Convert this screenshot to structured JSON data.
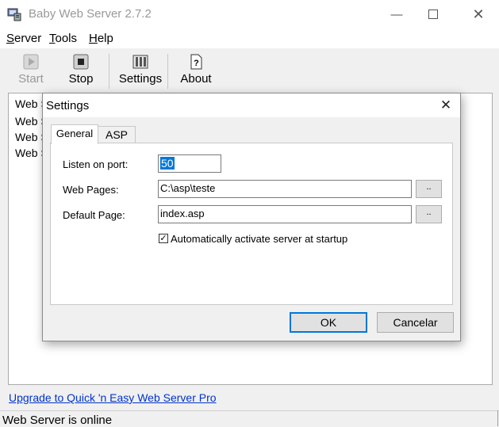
{
  "window": {
    "title": "Baby Web Server 2.7.2"
  },
  "menu": {
    "server_first": "S",
    "server_rest": "erver",
    "tools_first": "T",
    "tools_rest": "ools",
    "help_first": "H",
    "help_rest": "elp"
  },
  "toolbar": {
    "start": "Start",
    "stop": "Stop",
    "settings": "Settings",
    "about": "About"
  },
  "main_list": {
    "lines": [
      "Web S",
      "Web S",
      "Web S",
      "Web S"
    ]
  },
  "upgrade_link": "Upgrade to Quick 'n Easy Web Server Pro",
  "status": "Web Server is online",
  "dialog": {
    "title": "Settings",
    "tabs": [
      "General",
      "ASP"
    ],
    "listen_label": "Listen on port:",
    "listen_value": "50",
    "web_pages_label": "Web Pages:",
    "web_pages_value": "C:\\asp\\teste",
    "default_page_label": "Default Page:",
    "default_page_value": "index.asp",
    "browse_label": "..",
    "autostart_label": "Automatically activate server at startup",
    "autostart_checked": "✓",
    "ok": "OK",
    "cancel": "Cancelar"
  },
  "colors": {
    "accent": "#0078d7",
    "link": "#0033cc",
    "disabled": "#999999"
  }
}
